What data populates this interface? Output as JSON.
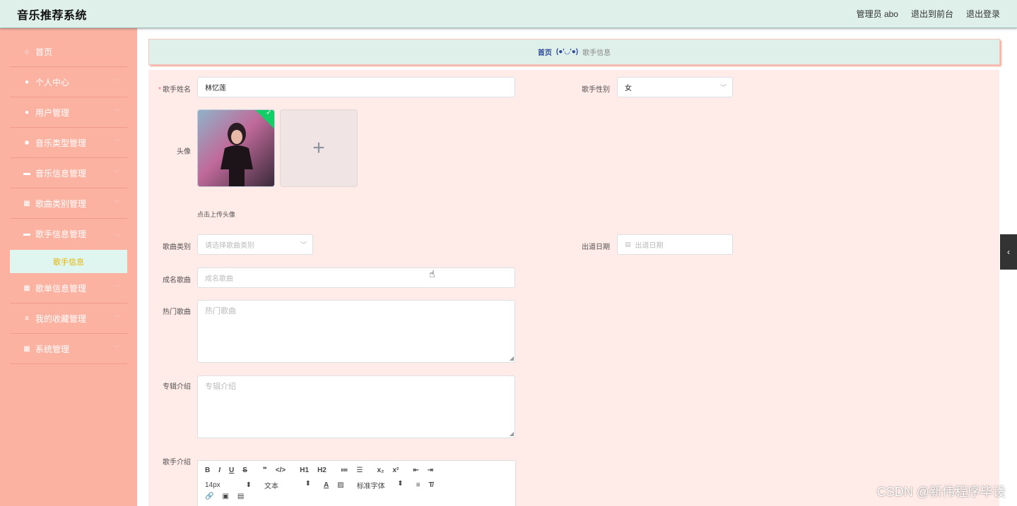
{
  "app": {
    "title": "音乐推荐系统"
  },
  "header": {
    "admin": "管理员 abo",
    "exit_front": "退出到前台",
    "logout": "退出登录"
  },
  "sidebar": {
    "items": [
      {
        "label": "首页",
        "icon": "home-icon",
        "glyph": "⌂"
      },
      {
        "label": "个人中心",
        "icon": "user-icon",
        "glyph": "●"
      },
      {
        "label": "用户管理",
        "icon": "user-icon",
        "glyph": "●"
      },
      {
        "label": "音乐类型管理",
        "icon": "bag-icon",
        "glyph": "■"
      },
      {
        "label": "音乐信息管理",
        "icon": "comment-icon",
        "glyph": "▬"
      },
      {
        "label": "歌曲类别管理",
        "icon": "grid-icon",
        "glyph": "▦"
      },
      {
        "label": "歌手信息管理",
        "icon": "briefcase-icon",
        "glyph": "▬"
      },
      {
        "label": "歌单信息管理",
        "icon": "grid-icon",
        "glyph": "▦"
      },
      {
        "label": "我的收藏管理",
        "icon": "list-icon",
        "glyph": "≡"
      },
      {
        "label": "系统管理",
        "icon": "grid-icon",
        "glyph": "▦"
      }
    ],
    "sub_active": "歌手信息"
  },
  "breadcrumb": {
    "home": "首页",
    "sep": "(●'◡'●)",
    "current": "歌手信息"
  },
  "form": {
    "singer_name": {
      "label": "歌手姓名",
      "value": "林忆莲"
    },
    "singer_gender": {
      "label": "歌手性别",
      "value": "女"
    },
    "avatar": {
      "label": "头像",
      "hint": "点击上传头像",
      "plus": "+"
    },
    "song_category": {
      "label": "歌曲类别",
      "placeholder": "请选择歌曲类别"
    },
    "debut_date": {
      "label": "出道日期",
      "placeholder": "出道日期"
    },
    "famous_song": {
      "label": "成名歌曲",
      "placeholder": "成名歌曲"
    },
    "hot_song": {
      "label": "热门歌曲",
      "placeholder": "热门歌曲"
    },
    "album_intro": {
      "label": "专辑介绍",
      "placeholder": "专辑介绍"
    },
    "singer_intro": {
      "label": "歌手介绍"
    }
  },
  "editor": {
    "row1": [
      "B",
      "I",
      "U",
      "S",
      "❞",
      "</>",
      "H1",
      "H2",
      "≔",
      "☰",
      "x₂",
      "x²",
      "⇤",
      "⇥"
    ],
    "font_size": "14px",
    "text_type": "文本",
    "font_family": "标准字体",
    "row3": [
      "🔗",
      "▣",
      "▤"
    ]
  },
  "watermark": "CSDN @新伟程序毕设",
  "colors": {
    "sidebar": "#fcb2a1",
    "topbar": "#dff0ea",
    "form_bg": "#ffebe7"
  }
}
